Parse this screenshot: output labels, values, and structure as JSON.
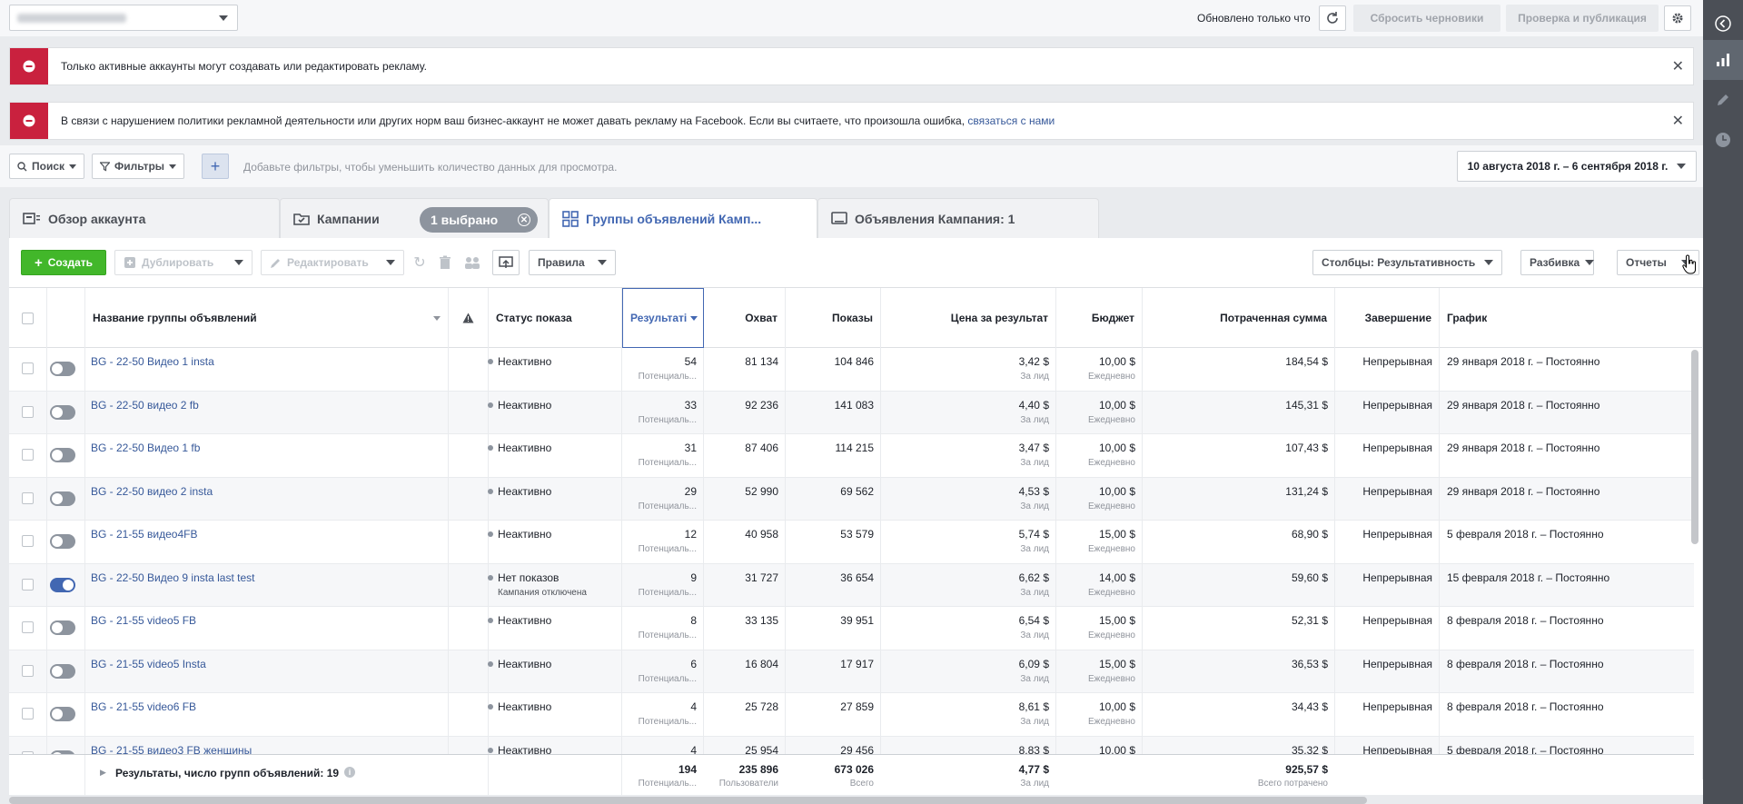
{
  "topbar": {
    "updated_text": "Обновлено только что",
    "discard_label": "Сбросить черновики",
    "review_label": "Проверка и публикация"
  },
  "alerts": [
    {
      "text": "Только активные аккаунты могут создавать или редактировать рекламу."
    },
    {
      "text": "В связи с нарушением политики рекламной деятельности или других норм ваш бизнес-аккаунт не может давать рекламу на Facebook. Если вы считаете, что произошла ошибка,",
      "link": "связаться с нами"
    }
  ],
  "filters": {
    "search_label": "Поиск",
    "filters_label": "Фильтры",
    "hint": "Добавьте фильтры, чтобы уменьшить количество данных для просмотра.",
    "date_range": "10 августа 2018 г. – 6 сентября 2018 г."
  },
  "tabs": {
    "overview": "Обзор аккаунта",
    "campaigns": "Кампании",
    "selected_pill": "1 выбрано",
    "adsets": "Группы объявлений Камп...",
    "ads": "Объявления Кампания: 1"
  },
  "toolbar": {
    "create": "Создать",
    "duplicate": "Дублировать",
    "edit": "Редактировать",
    "rules": "Правила",
    "columns": "Столбцы: Результативность",
    "breakdown": "Разбивка",
    "reports": "Отчеты"
  },
  "table": {
    "headers": {
      "name": "Название группы объявлений",
      "status": "Статус показа",
      "results": "Результаті",
      "reach": "Охват",
      "impressions": "Показы",
      "cost": "Цена за результат",
      "budget": "Бюджет",
      "spent": "Потраченная сумма",
      "end": "Завершение",
      "schedule": "График"
    },
    "rows": [
      {
        "on": false,
        "name": "BG - 22-50 Видео 1 insta",
        "status": "Неактивно",
        "status2": "",
        "results": "54",
        "results_sub": "Потенциаль...",
        "reach": "81 134",
        "impr": "104 846",
        "cost": "3,42 $",
        "cost_sub": "За лид",
        "budget": "10,00 $",
        "budget_sub": "Ежедневно",
        "spent": "184,54 $",
        "end": "Непрерывная",
        "sched": "29 января 2018 г. – Постоянно"
      },
      {
        "on": false,
        "name": "BG - 22-50 видео 2 fb",
        "status": "Неактивно",
        "status2": "",
        "results": "33",
        "results_sub": "Потенциаль...",
        "reach": "92 236",
        "impr": "141 083",
        "cost": "4,40 $",
        "cost_sub": "За лид",
        "budget": "10,00 $",
        "budget_sub": "Ежедневно",
        "spent": "145,31 $",
        "end": "Непрерывная",
        "sched": "29 января 2018 г. – Постоянно"
      },
      {
        "on": false,
        "name": "BG - 22-50 Видео 1 fb",
        "status": "Неактивно",
        "status2": "",
        "results": "31",
        "results_sub": "Потенциаль...",
        "reach": "87 406",
        "impr": "114 215",
        "cost": "3,47 $",
        "cost_sub": "За лид",
        "budget": "10,00 $",
        "budget_sub": "Ежедневно",
        "spent": "107,43 $",
        "end": "Непрерывная",
        "sched": "29 января 2018 г. – Постоянно"
      },
      {
        "on": false,
        "name": "BG - 22-50 видео 2 insta",
        "status": "Неактивно",
        "status2": "",
        "results": "29",
        "results_sub": "Потенциаль...",
        "reach": "52 990",
        "impr": "69 562",
        "cost": "4,53 $",
        "cost_sub": "За лид",
        "budget": "10,00 $",
        "budget_sub": "Ежедневно",
        "spent": "131,24 $",
        "end": "Непрерывная",
        "sched": "29 января 2018 г. – Постоянно"
      },
      {
        "on": false,
        "name": "BG - 21-55 видео4FB",
        "status": "Неактивно",
        "status2": "",
        "results": "12",
        "results_sub": "Потенциаль...",
        "reach": "40 958",
        "impr": "53 579",
        "cost": "5,74 $",
        "cost_sub": "За лид",
        "budget": "15,00 $",
        "budget_sub": "Ежедневно",
        "spent": "68,90 $",
        "end": "Непрерывная",
        "sched": "5 февраля 2018 г. – Постоянно"
      },
      {
        "on": true,
        "name": "BG - 22-50 Видео 9 insta last test",
        "status": "Нет показов",
        "status2": "Кампания отключена",
        "results": "9",
        "results_sub": "Потенциаль...",
        "reach": "31 727",
        "impr": "36 654",
        "cost": "6,62 $",
        "cost_sub": "За лид",
        "budget": "14,00 $",
        "budget_sub": "Ежедневно",
        "spent": "59,60 $",
        "end": "Непрерывная",
        "sched": "15 февраля 2018 г. – Постоянно"
      },
      {
        "on": false,
        "name": "BG - 21-55 video5 FB",
        "status": "Неактивно",
        "status2": "",
        "results": "8",
        "results_sub": "Потенциаль...",
        "reach": "33 135",
        "impr": "39 951",
        "cost": "6,54 $",
        "cost_sub": "За лид",
        "budget": "15,00 $",
        "budget_sub": "Ежедневно",
        "spent": "52,31 $",
        "end": "Непрерывная",
        "sched": "8 февраля 2018 г. – Постоянно"
      },
      {
        "on": false,
        "name": "BG - 21-55 video5 Insta",
        "status": "Неактивно",
        "status2": "",
        "results": "6",
        "results_sub": "Потенциаль...",
        "reach": "16 804",
        "impr": "17 917",
        "cost": "6,09 $",
        "cost_sub": "За лид",
        "budget": "15,00 $",
        "budget_sub": "Ежедневно",
        "spent": "36,53 $",
        "end": "Непрерывная",
        "sched": "8 февраля 2018 г. – Постоянно"
      },
      {
        "on": false,
        "name": "BG - 21-55 video6 FB",
        "status": "Неактивно",
        "status2": "",
        "results": "4",
        "results_sub": "Потенциаль...",
        "reach": "25 728",
        "impr": "27 859",
        "cost": "8,61 $",
        "cost_sub": "За лид",
        "budget": "10,00 $",
        "budget_sub": "Ежедневно",
        "spent": "34,43 $",
        "end": "Непрерывная",
        "sched": "8 февраля 2018 г. – Постоянно"
      },
      {
        "on": false,
        "name": "BG - 21-55 видео3 FB женщины",
        "status": "Неактивно",
        "status2": "",
        "results": "4",
        "results_sub": "",
        "reach": "25 954",
        "impr": "29 456",
        "cost": "8,83 $",
        "cost_sub": "",
        "budget": "10,00 $",
        "budget_sub": "",
        "spent": "35,32 $",
        "end": "Непрерывная",
        "sched": "5 февраля 2018 г. – Постоянно"
      }
    ],
    "footer": {
      "label": "Результаты, число групп объявлений: 19",
      "results": "194",
      "results_sub": "Потенциаль...",
      "reach": "235 896",
      "reach_sub": "Пользователи",
      "impr": "673 026",
      "impr_sub": "Всего",
      "cost": "4,77 $",
      "cost_sub": "За лид",
      "spent": "925,57 $",
      "spent_sub": "Всего потрачено"
    }
  },
  "colors": {
    "accent": "#4267b2",
    "create_green": "#42b72a",
    "alert_red": "#c9213e",
    "link": "#365899"
  }
}
